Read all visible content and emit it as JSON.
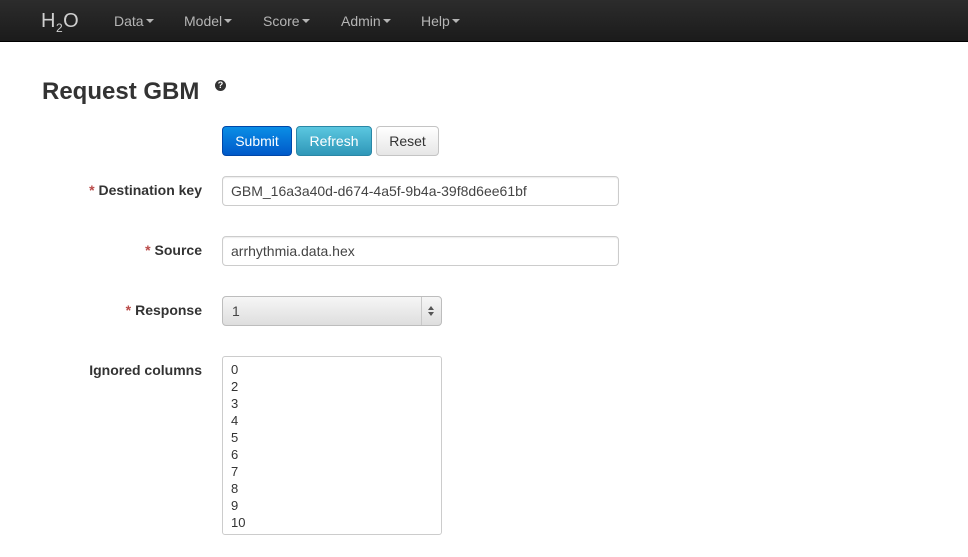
{
  "navbar": {
    "brand": {
      "pre": "H",
      "sub": "2",
      "post": "O"
    },
    "items": [
      {
        "label": "Data"
      },
      {
        "label": "Model"
      },
      {
        "label": "Score"
      },
      {
        "label": "Admin"
      },
      {
        "label": "Help"
      }
    ]
  },
  "page": {
    "title": "Request GBM",
    "help_icon": "question-circle-icon",
    "help_glyph": "?"
  },
  "buttons": {
    "submit": "Submit",
    "refresh": "Refresh",
    "reset": "Reset"
  },
  "form": {
    "required_marker": "*",
    "destination_key": {
      "label": "Destination key",
      "value": "GBM_16a3a40d-d674-4a5f-9b4a-39f8d6ee61bf"
    },
    "source": {
      "label": "Source",
      "value": "arrhythmia.data.hex"
    },
    "response": {
      "label": "Response",
      "value": "1"
    },
    "ignored_columns": {
      "label": "Ignored columns",
      "options": [
        "0",
        "2",
        "3",
        "4",
        "5",
        "6",
        "7",
        "8",
        "9",
        "10"
      ]
    }
  },
  "colors": {
    "navbar_bg": "#1b1b1b",
    "primary": "#0059c9",
    "info": "#2f97b8",
    "required": "#b94a48"
  }
}
